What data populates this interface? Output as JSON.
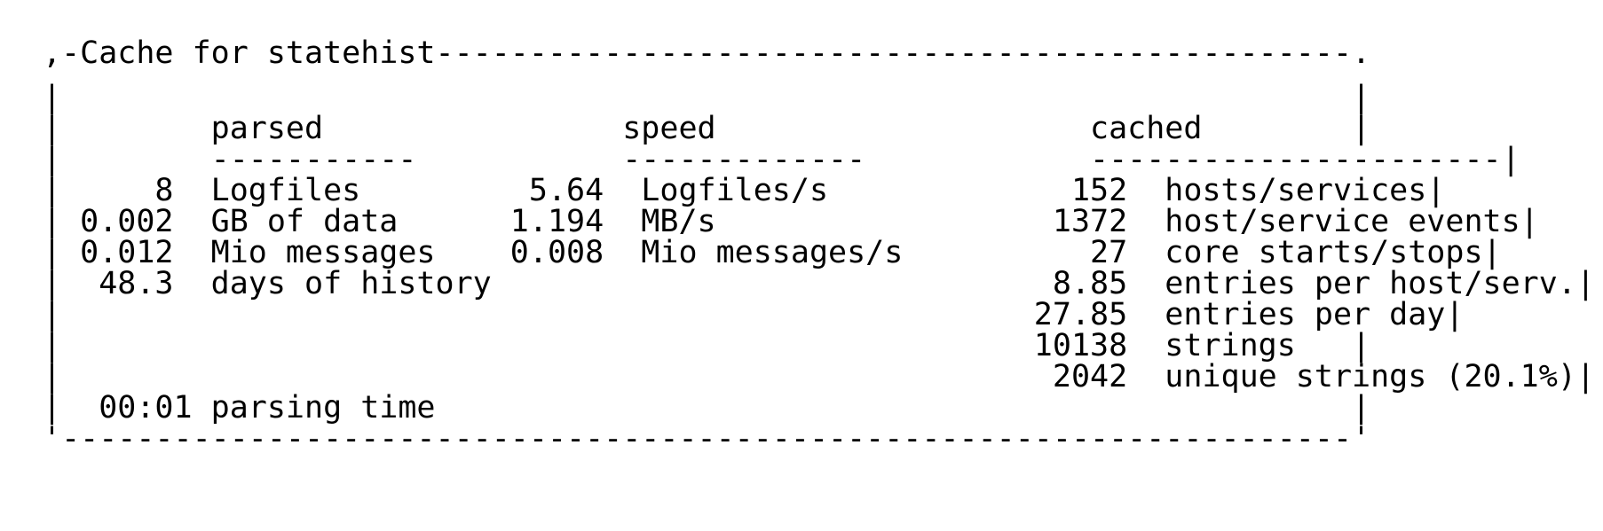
{
  "title": "Cache for statehist",
  "headers": {
    "parsed": "parsed",
    "speed": "speed",
    "cached": "cached"
  },
  "rows": [
    {
      "parsed_val": "8",
      "parsed_label": "Logfiles",
      "speed_val": "5.64",
      "speed_label": "Logfiles/s",
      "cached_val": "152",
      "cached_label": "hosts/services"
    },
    {
      "parsed_val": "0.002",
      "parsed_label": "GB of data",
      "speed_val": "1.194",
      "speed_label": "MB/s",
      "cached_val": "1372",
      "cached_label": "host/service events"
    },
    {
      "parsed_val": "0.012",
      "parsed_label": "Mio messages",
      "speed_val": "0.008",
      "speed_label": "Mio messages/s",
      "cached_val": "27",
      "cached_label": "core starts/stops"
    },
    {
      "parsed_val": "48.3",
      "parsed_label": "days of history",
      "speed_val": "",
      "speed_label": "",
      "cached_val": "8.85",
      "cached_label": "entries per host/serv."
    },
    {
      "parsed_val": "",
      "parsed_label": "",
      "speed_val": "",
      "speed_label": "",
      "cached_val": "27.85",
      "cached_label": "entries per day"
    },
    {
      "parsed_val": "",
      "parsed_label": "",
      "speed_val": "",
      "speed_label": "",
      "cached_val": "10138",
      "cached_label": "strings"
    },
    {
      "parsed_val": "",
      "parsed_label": "",
      "speed_val": "",
      "speed_label": "",
      "cached_val": "2042",
      "cached_label": "unique strings (20.1%)"
    }
  ],
  "parsing_time": {
    "value": "00:01",
    "label": "parsing time"
  }
}
